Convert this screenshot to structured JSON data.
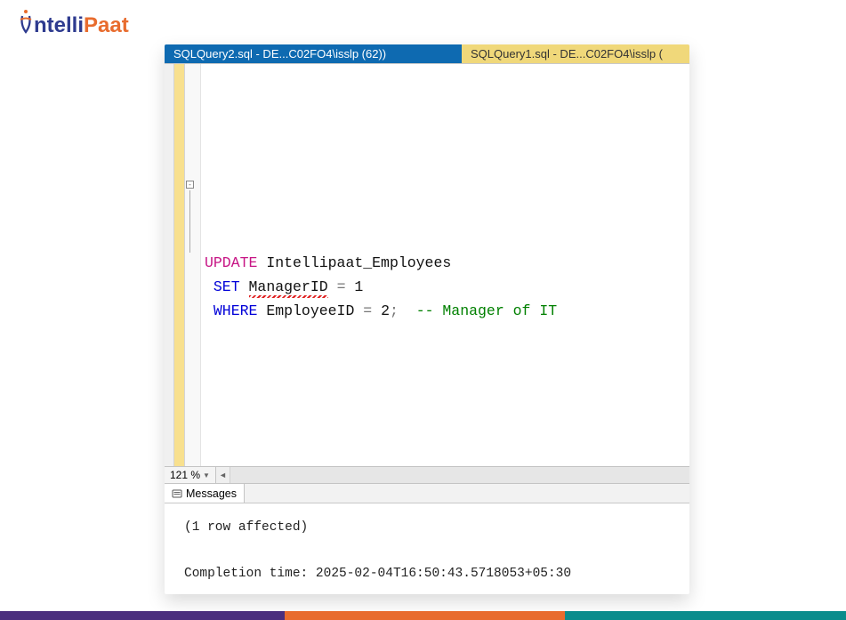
{
  "brand": {
    "name_left": "ntelli",
    "name_right": "Paat"
  },
  "tabs": {
    "active": "SQLQuery2.sql - DE...C02FO4\\isslp (62))",
    "inactive": "SQLQuery1.sql - DE...C02FO4\\isslp ("
  },
  "code": {
    "kw_update": "UPDATE",
    "table": "Intellipaat_Employees",
    "kw_set": "SET",
    "col_mgr": "ManagerID",
    "eq1": "=",
    "val1": "1",
    "kw_where": "WHERE",
    "col_emp": "EmployeeID",
    "eq2": "=",
    "val2": "2",
    "semi": ";",
    "comment": "-- Manager of IT"
  },
  "zoom": {
    "value": "121 %"
  },
  "messages": {
    "tab_label": "Messages",
    "rows_affected": "(1 row affected)",
    "completion": "Completion time: 2025-02-04T16:50:43.5718053+05:30"
  },
  "collapse": {
    "symbol": "-"
  }
}
